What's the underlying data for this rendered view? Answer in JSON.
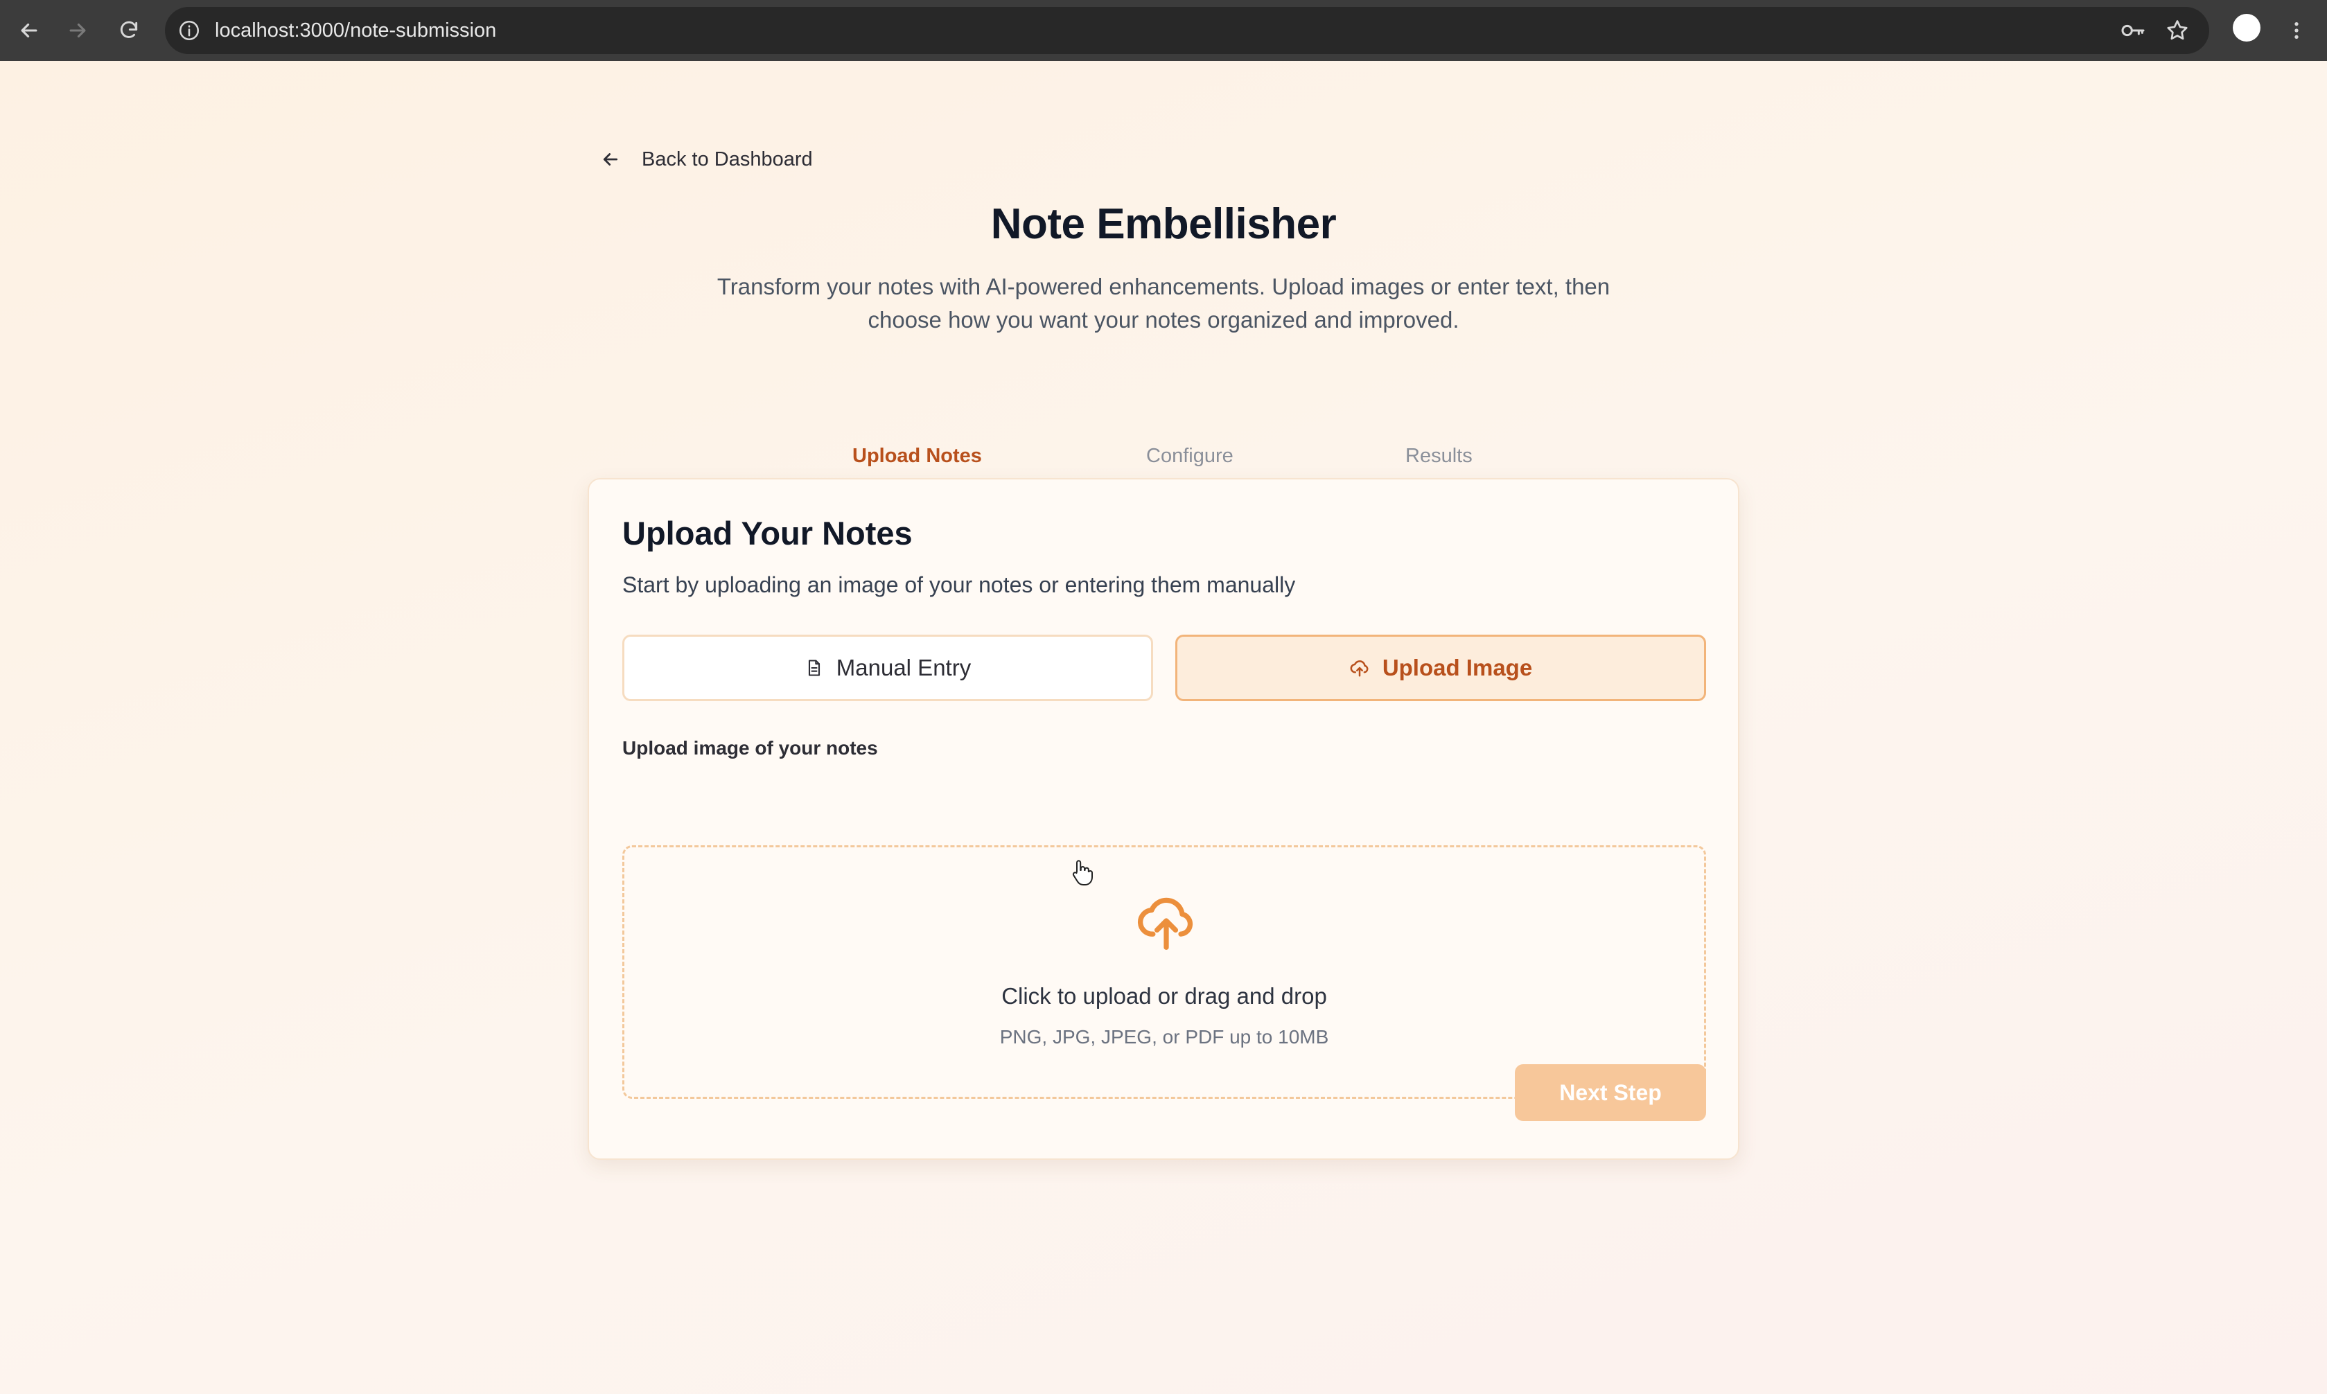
{
  "browser": {
    "url": "localhost:3000/note-submission",
    "icons": [
      "back-arrow-icon",
      "forward-arrow-icon",
      "reload-icon",
      "info-icon",
      "password-key-icon",
      "bookmark-star-icon",
      "profile-avatar",
      "more-menu-icon"
    ]
  },
  "page": {
    "back_link": {
      "icon": "arrow-left-icon",
      "label": "Back to Dashboard"
    },
    "title": "Note Embellisher",
    "subtitle": "Transform your notes with AI-powered enhancements. Upload images or enter text, then choose how you want your notes organized and improved."
  },
  "steps": {
    "items": [
      {
        "label": "Upload Notes",
        "state": "active"
      },
      {
        "label": "Configure",
        "state": "inactive"
      },
      {
        "label": "Results",
        "state": "inactive"
      }
    ],
    "progress_fraction": 0.33,
    "accent_color": "#f0a04b"
  },
  "card": {
    "title": "Upload Your Notes",
    "description": "Start by uploading an image of your notes or entering them manually",
    "modes": {
      "manual": {
        "label": "Manual Entry",
        "icon": "document-icon",
        "selected": false
      },
      "upload": {
        "label": "Upload Image",
        "icon": "cloud-upload-icon",
        "selected": true
      }
    },
    "upload_label": "Upload image of your notes",
    "dropzone": {
      "icon": "cloud-upload-icon",
      "main_text": "Click to upload or drag and drop",
      "sub_text": "PNG, JPG, JPEG, or PDF up to 10MB"
    },
    "next_button": {
      "label": "Next Step",
      "disabled": true
    }
  }
}
